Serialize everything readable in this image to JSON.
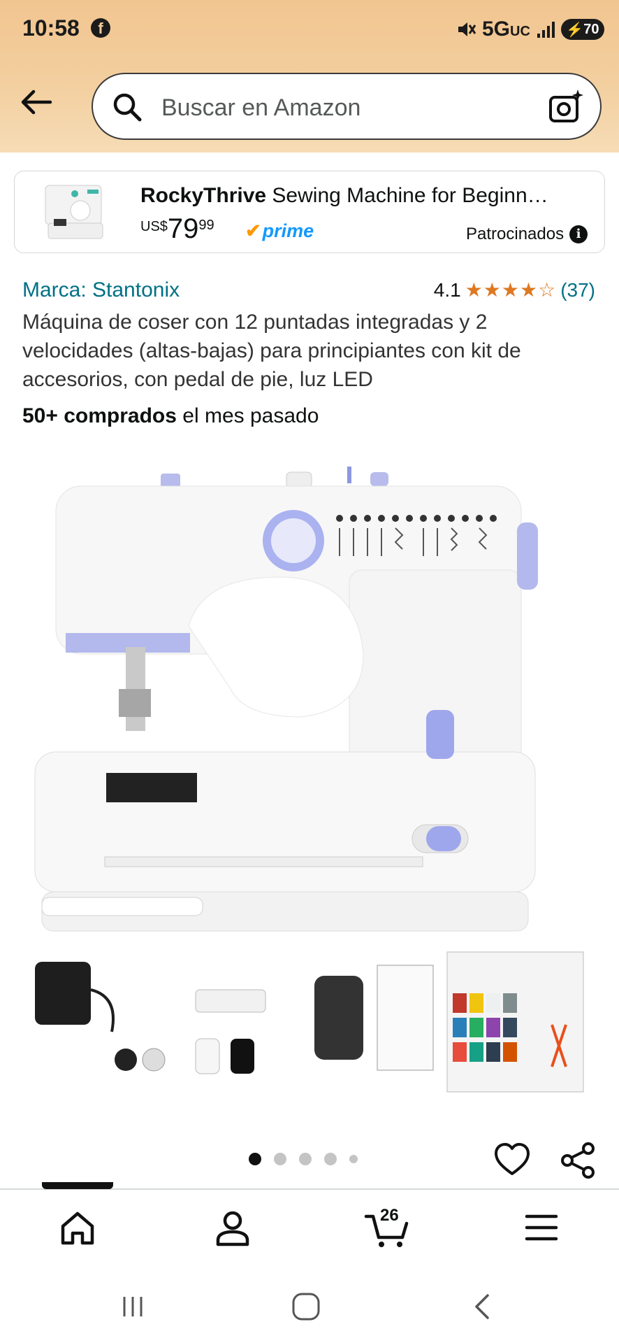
{
  "status_bar": {
    "time": "10:58",
    "network": "5G",
    "network_sub": "UC",
    "battery": "70"
  },
  "search": {
    "placeholder": "Buscar en Amazon"
  },
  "sponsored_ad": {
    "brand": "RockyThrive",
    "title_rest": " Sewing Machine for Beginn…",
    "currency": "US$",
    "price_whole": "79",
    "price_fraction": "99",
    "prime": "prime",
    "sponsored_label": "Patrocinados"
  },
  "product": {
    "brand_link": "Marca: Stantonix",
    "rating": "4.1",
    "stars": "★★★★☆",
    "rating_count": "(37)",
    "title": "Máquina de coser con 12 puntadas integradas y 2 velocidades (altas-bajas) para principiantes con kit de accesorios, con pedal de pie, luz LED",
    "bought_bold": "50+ comprados",
    "bought_rest": " el mes pasado",
    "image_count": 5,
    "active_image": 1
  },
  "bottom_nav": {
    "items": [
      "home-icon",
      "account-icon",
      "cart-icon",
      "menu-icon"
    ],
    "cart_count": "26"
  },
  "colors": {
    "link": "#007185",
    "star": "#de7921",
    "prime": "#1399ff",
    "header": "#f3cf9f"
  }
}
